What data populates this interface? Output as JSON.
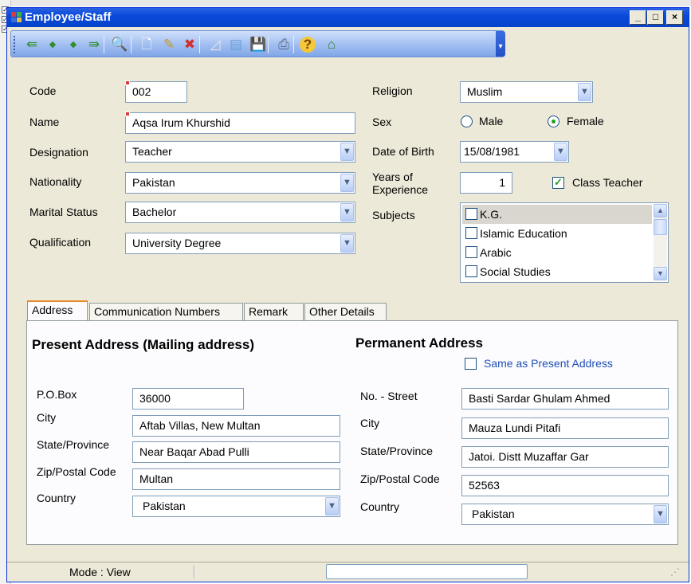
{
  "window": {
    "title": "Employee/Staff"
  },
  "toolbar": {
    "buttons": [
      {
        "name": "first-record-icon",
        "glyph": "⇚",
        "color": "#2f8f2f"
      },
      {
        "name": "previous-record-icon",
        "glyph": "◆",
        "color": "#2f8f2f"
      },
      {
        "name": "next-record-icon",
        "glyph": "◆",
        "color": "#2f8f2f"
      },
      {
        "name": "last-record-icon",
        "glyph": "⇛",
        "color": "#2f8f2f"
      },
      {
        "name": "search-icon",
        "glyph": "🔍",
        "color": "#3a5aa8"
      },
      {
        "name": "new-record-icon",
        "glyph": "🗋",
        "color": "#ffffff"
      },
      {
        "name": "edit-record-icon",
        "glyph": "✎",
        "color": "#c49a2c"
      },
      {
        "name": "delete-record-icon",
        "glyph": "✖",
        "color": "#d03030"
      },
      {
        "name": "undo-icon",
        "glyph": "◿",
        "color": "#e6e6e6"
      },
      {
        "name": "browse-icon",
        "glyph": "▤",
        "color": "#6aa0d8"
      },
      {
        "name": "save-icon",
        "glyph": "💾",
        "color": "#3a4a6a"
      },
      {
        "name": "print-icon",
        "glyph": "⎙",
        "color": "#5a6a8a"
      },
      {
        "name": "help-icon",
        "glyph": "?",
        "color": "#c77d00"
      },
      {
        "name": "home-icon",
        "glyph": "⌂",
        "color": "#2f7f2f"
      }
    ]
  },
  "labels": {
    "code": "Code",
    "name": "Name",
    "designation": "Designation",
    "nationality": "Nationality",
    "marital_status": "Marital Status",
    "qualification": "Qualification",
    "religion": "Religion",
    "sex": "Sex",
    "date_of_birth": "Date of Birth",
    "years_of_experience_1": "Years of",
    "years_of_experience_2": "Experience",
    "subjects": "Subjects"
  },
  "values": {
    "code": "002",
    "name": "Aqsa Irum Khurshid",
    "designation": "Teacher",
    "nationality": "Pakistan",
    "marital_status": "Bachelor",
    "qualification": "University Degree",
    "religion": "Muslim",
    "date_of_birth": "15/08/1981",
    "years_of_experience": "1"
  },
  "sex": {
    "male": "Male",
    "female": "Female",
    "selected": "Female"
  },
  "class_teacher": {
    "label": "Class Teacher",
    "checked": true
  },
  "subjects": [
    {
      "label": "K.G.",
      "checked": false,
      "selected": true
    },
    {
      "label": "Islamic Education",
      "checked": false,
      "selected": false
    },
    {
      "label": "Arabic",
      "checked": false,
      "selected": false
    },
    {
      "label": "Social Studies",
      "checked": false,
      "selected": false
    }
  ],
  "tabs": [
    "Address",
    "Communication Numbers",
    "Remark",
    "Other Details"
  ],
  "address": {
    "present_heading": "Present  Address (Mailing address)",
    "permanent_heading": "Permanent Address",
    "same_as_present": "Same as Present Address",
    "same_as_present_color": "#1f4fb8",
    "present": {
      "labels": [
        "P.O.Box",
        "City",
        "State/Province",
        "Zip/Postal Code",
        "Country"
      ],
      "po_box": "36000",
      "city": "Aftab Villas, New Multan",
      "state": "Near Baqar Abad Pulli",
      "zip": "Multan",
      "country": "Pakistan"
    },
    "permanent": {
      "labels": [
        "No. - Street",
        "City",
        "State/Province",
        "Zip/Postal Code",
        "Country"
      ],
      "street": "Basti Sardar Ghulam Ahmed",
      "city": "Mauza Lundi Pitafi",
      "state": "Jatoi. Distt Muzaffar Gar",
      "zip": "52563",
      "country": "Pakistan"
    }
  },
  "status": {
    "mode": "Mode : View"
  }
}
